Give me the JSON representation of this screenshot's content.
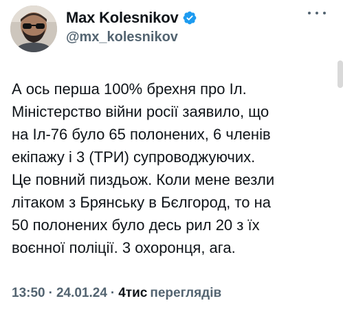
{
  "author": {
    "name": "Max Kolesnikov",
    "handle": "@mx_kolesnikov",
    "verified": true,
    "avatar_icon": "avatar-photo"
  },
  "menu_icon": "more-horizontal-icon",
  "tweet": {
    "lines": [
      "А ось перша 100% брехня про Іл.",
      "Міністерство війни росії заявило, що",
      "на Іл-76 було 65 полонених, 6 членів",
      "екіпажу і 3 (ТРИ) супроводжуючих.",
      "Це повний пиздьож. Коли мене везли",
      "літаком з Брянську в Бєлгород, то на",
      "50 полонених було десь рил 20 з їх",
      "воєнної поліції. 3 охоронця, ага."
    ]
  },
  "meta": {
    "time": "13:50",
    "date": "24.01.24",
    "views_count": "4тис",
    "views_label": "переглядів"
  },
  "colors": {
    "text": "#0f1419",
    "secondary": "#536471",
    "verified_badge": "#1d9bf0"
  }
}
